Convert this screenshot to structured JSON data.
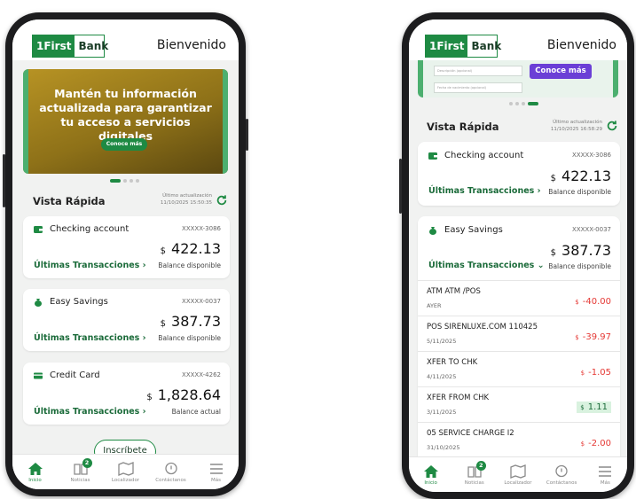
{
  "brand": {
    "logo_mark": "1First",
    "logo_text": "Bank",
    "color": "#1e8a43"
  },
  "header": {
    "welcome": "Bienvenido"
  },
  "banner": {
    "title": "Mantén tu información actualizada para garantizar tu acceso a servicios digitales",
    "button": "Conoce más",
    "form_field_1": "Descripción (opcional)",
    "form_field_2": "Fecha de nacimiento (opcional)"
  },
  "quick_view": {
    "title": "Vista Rápida",
    "left": {
      "update_label": "Último actualización",
      "update_time": "11/10/2025 15:50:35"
    },
    "right": {
      "update_label": "Último actualización",
      "update_time": "11/10/2025 16:58:29"
    }
  },
  "accounts": [
    {
      "name": "Checking account",
      "number": "XXXXX-3086",
      "currency": "$",
      "amount": "422.13",
      "balance_label": "Balance disponible",
      "link": "Últimas Transacciones ›",
      "icon": "wallet-icon"
    },
    {
      "name": "Easy Savings",
      "number": "XXXXX-0037",
      "currency": "$",
      "amount": "387.73",
      "balance_label": "Balance disponible",
      "link": "Últimas Transacciones ›",
      "link_expanded": "Últimas Transacciones ⌄",
      "icon": "money-bag-icon"
    },
    {
      "name": "Credit Card",
      "number": "XXXXX-4262",
      "currency": "$",
      "amount": "1,828.64",
      "balance_label": "Balance actual",
      "link": "Últimas Transacciones ›",
      "icon": "credit-card-icon"
    }
  ],
  "transactions": [
    {
      "desc": "ATM ATM /POS",
      "date": "AYER",
      "currency": "$",
      "amount": "-40.00",
      "type": "debit"
    },
    {
      "desc": "POS SIRENLUXE.COM 110425",
      "date": "5/11/2025",
      "currency": "$",
      "amount": "-39.97",
      "type": "debit"
    },
    {
      "desc": "XFER TO CHK",
      "date": "4/11/2025",
      "currency": "$",
      "amount": "-1.05",
      "type": "debit"
    },
    {
      "desc": "XFER FROM CHK",
      "date": "3/11/2025",
      "currency": "$",
      "amount": "1.11",
      "type": "credit"
    },
    {
      "desc": "05 SERVICE CHARGE I2",
      "date": "31/10/2025",
      "currency": "$",
      "amount": "-2.00",
      "type": "debit"
    }
  ],
  "subscribe_button": "Inscríbete",
  "nav": [
    {
      "label": "Inicio",
      "icon": "home-icon"
    },
    {
      "label": "Noticias",
      "icon": "news-icon",
      "badge": "2"
    },
    {
      "label": "Localizador",
      "icon": "map-icon"
    },
    {
      "label": "Contáctanos",
      "icon": "chat-icon"
    },
    {
      "label": "Más",
      "icon": "menu-icon"
    }
  ],
  "colors": {
    "accent": "#1e8a43",
    "debit": "#e53935",
    "credit_bg": "#d9f2df",
    "banner_gold": "#b79324"
  }
}
